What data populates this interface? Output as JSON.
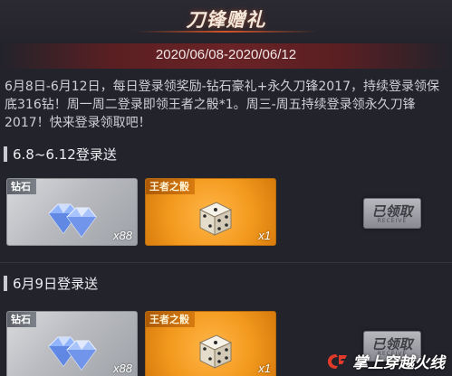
{
  "header": {
    "title": "刀锋赠礼",
    "date_range": "2020/06/08-2020/06/12"
  },
  "description": "6月8日-6月12日，每日登录领奖励-钻石豪礼+永久刀锋2017，持续登录领保底316钻！周一周二登录即领王者之骰*1。周三-周五持续登录领永久刀锋2017！快来登录领取吧！",
  "sections": [
    {
      "heading": "6.8~6.12登录送",
      "rewards": [
        {
          "label": "钻石",
          "count": "x88",
          "icon": "diamond-icon"
        },
        {
          "label": "王者之骰",
          "count": "x1",
          "icon": "dice-icon"
        }
      ],
      "button": {
        "label": "已领取",
        "sub": "RECEIVE"
      }
    },
    {
      "heading": "6月9日登录送",
      "rewards": [
        {
          "label": "钻石",
          "count": "x88",
          "icon": "diamond-icon"
        },
        {
          "label": "王者之骰",
          "count": "x1",
          "icon": "dice-icon"
        }
      ],
      "button": {
        "label": "已领取",
        "sub": "RECEIVE"
      }
    }
  ],
  "watermark": {
    "text": "掌上穿越火线",
    "icon": "cf-logo-icon"
  },
  "colors": {
    "background": "#23232b",
    "date_band": "#6a2326",
    "silver_card": "#b9bbc0",
    "gold_card": "#f39a1e",
    "button": "#9c9da3"
  }
}
